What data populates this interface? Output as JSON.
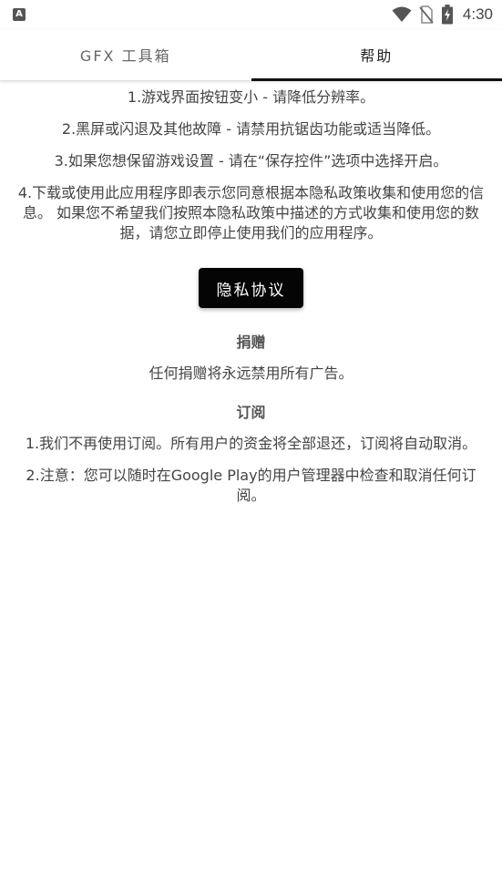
{
  "status_bar": {
    "left_icon": "A",
    "time": "4:30",
    "icons": [
      "wifi-icon",
      "no-sim-icon",
      "battery-charging-icon"
    ]
  },
  "tabs": [
    {
      "label": "GFX 工具箱",
      "active": false
    },
    {
      "label": "帮助",
      "active": true
    }
  ],
  "help": {
    "items": [
      "1.游戏界面按钮变小 - 请降低分辨率。",
      "2.黑屏或闪退及其他故障 - 请禁用抗锯齿功能或适当降低。",
      "3.如果您想保留游戏设置 - 请在“保存控件”选项中选择开启。",
      "4.下载或使用此应用程序即表示您同意根据本隐私政策收集和使用您的信息。 如果您不希望我们按照本隐私政策中描述的方式收集和使用您的数据，请您立即停止使用我们的应用程序。"
    ],
    "privacy_button": "隐私协议"
  },
  "donation": {
    "title": "捐赠",
    "text": "任何捐赠将永远禁用所有广告。"
  },
  "subscription": {
    "title": "订阅",
    "items": [
      "1.我们不再使用订阅。所有用户的资金将全部退还，订阅将自动取消。",
      "2.注意：您可以随时在Google Play的用户管理器中检查和取消任何订阅。"
    ]
  }
}
